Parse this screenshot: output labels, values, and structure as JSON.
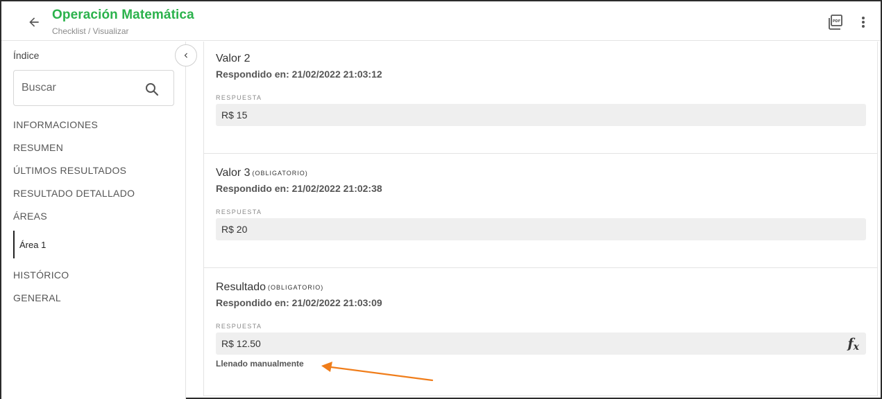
{
  "header": {
    "title": "Operación Matemática",
    "breadcrumb": "Checklist / Visualizar"
  },
  "sidebar": {
    "title": "Índice",
    "search_placeholder": "Buscar",
    "items": [
      {
        "label": "INFORMACIONES"
      },
      {
        "label": "RESUMEN"
      },
      {
        "label": "ÚLTIMOS RESULTADOS"
      },
      {
        "label": "RESULTADO DETALLADO"
      },
      {
        "label": "ÁREAS"
      }
    ],
    "subitem": "Área 1",
    "items_after": [
      {
        "label": "HISTÓRICO"
      },
      {
        "label": "GENERAL"
      }
    ]
  },
  "questions": [
    {
      "title": "Valor 2",
      "required": "",
      "answered": "Respondido en: 21/02/2022 21:03:12",
      "response_label": "RESPUESTA",
      "answer": "R$ 15"
    },
    {
      "title": "Valor 3",
      "required": "(OBLIGATORIO)",
      "answered": "Respondido en: 21/02/2022 21:02:38",
      "response_label": "RESPUESTA",
      "answer": "R$ 20"
    },
    {
      "title": "Resultado",
      "required": "(OBLIGATORIO)",
      "answered": "Respondido en: 21/02/2022 21:03:09",
      "response_label": "RESPUESTA",
      "answer": "R$ 12.50",
      "note": "Llenado manualmente"
    }
  ],
  "icons": {
    "back": "arrow-left-icon",
    "pdf": "pdf-icon",
    "more": "more-vertical-icon",
    "search": "search-icon",
    "collapse": "chevron-left-icon",
    "formula": "fx-icon"
  },
  "colors": {
    "title": "#2bb24c",
    "annotation_arrow": "#f07d1a"
  }
}
